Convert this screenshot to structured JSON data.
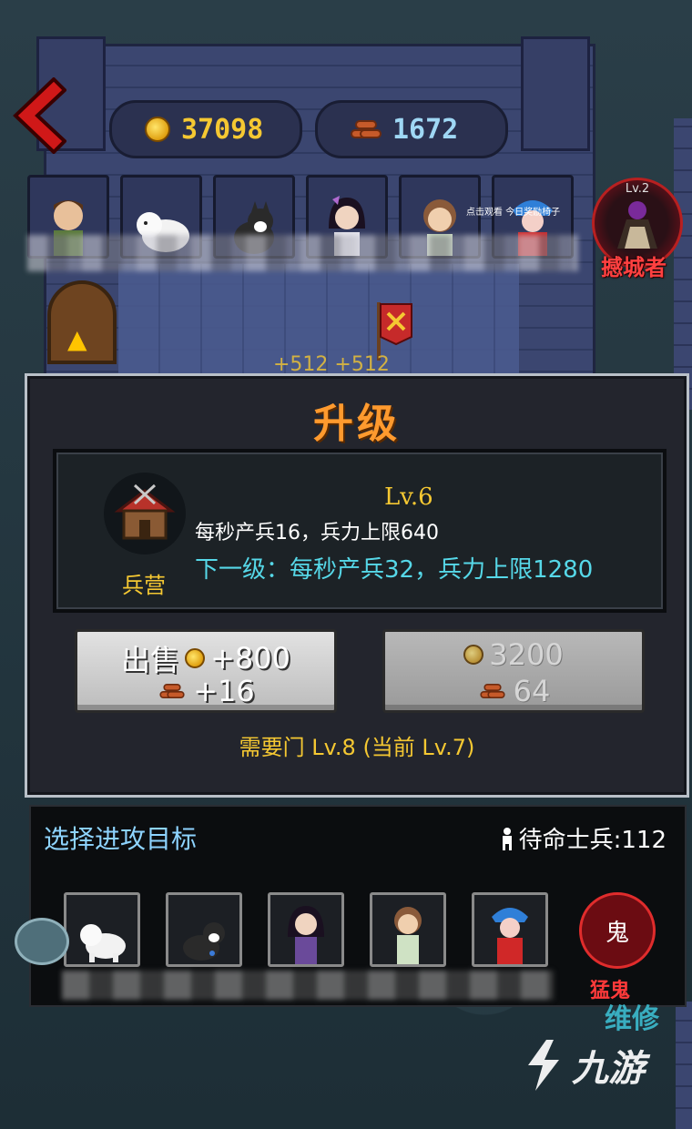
{
  "resources": {
    "coins": "37098",
    "wood": "1672"
  },
  "hero_note": "点击观看 今日奖励椅子",
  "boss": {
    "level": "Lv.2",
    "name": "撼城者"
  },
  "floor_income": "+512 +512",
  "dialog": {
    "title": "升级",
    "building_name": "兵营",
    "level": "Lv.6",
    "current_stats": "每秒产兵16，兵力上限640",
    "next_level_stats": "下一级：每秒产兵32，兵力上限1280",
    "sell_label": "出售",
    "sell_coins": "+800",
    "sell_wood": "+16",
    "upgrade_coins": "3200",
    "upgrade_wood": "64",
    "requirement": "需要门 Lv.8 (当前 Lv.7)"
  },
  "target_panel": {
    "title": "选择进攻目标",
    "standby_label": "待命士兵:112",
    "ghost_glyph": "鬼",
    "ghost_name": "猛鬼"
  },
  "maintain_label": "维修",
  "logo_text": "九游",
  "colors": {
    "gold": "#f5c832",
    "title_orange": "#ff9a2e",
    "cyan": "#56d8e8",
    "danger_red": "#ff3a3a"
  }
}
